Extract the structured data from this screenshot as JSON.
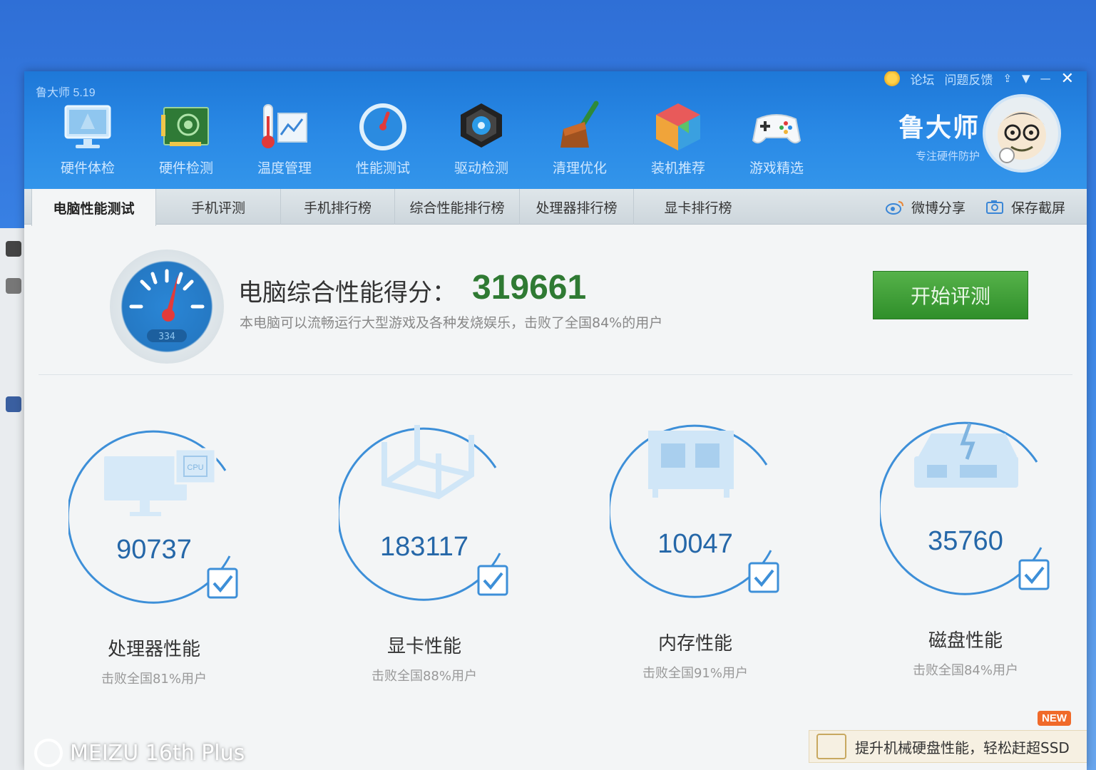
{
  "window": {
    "title": "鲁大师 5.19"
  },
  "title_links": {
    "forum": "论坛",
    "feedback": "问题反馈"
  },
  "toolbar": [
    {
      "label": "硬件体检",
      "icon": "monitor-icon"
    },
    {
      "label": "硬件检测",
      "icon": "circuit-board-icon"
    },
    {
      "label": "温度管理",
      "icon": "thermometer-icon"
    },
    {
      "label": "性能测试",
      "icon": "speedometer-icon"
    },
    {
      "label": "驱动检测",
      "icon": "driver-gear-icon"
    },
    {
      "label": "清理优化",
      "icon": "broom-icon"
    },
    {
      "label": "装机推荐",
      "icon": "cube-icon"
    },
    {
      "label": "游戏精选",
      "icon": "gamepad-icon"
    }
  ],
  "brand": {
    "name": "鲁大师",
    "slogan": "专注硬件防护"
  },
  "tabs": [
    {
      "label": "电脑性能测试",
      "active": true
    },
    {
      "label": "手机评测",
      "active": false
    },
    {
      "label": "手机排行榜",
      "active": false
    },
    {
      "label": "综合性能排行榜",
      "active": false
    },
    {
      "label": "处理器排行榜",
      "active": false
    },
    {
      "label": "显卡排行榜",
      "active": false
    }
  ],
  "tab_actions": {
    "weibo_share": "微博分享",
    "save_screenshot": "保存截屏"
  },
  "score": {
    "label": "电脑综合性能得分：",
    "value": "319661",
    "description": "本电脑可以流畅运行大型游戏及各种发烧娱乐，击败了全国84%的用户",
    "gauge_text": "334"
  },
  "start_button": "开始评测",
  "metrics": [
    {
      "name": "处理器性能",
      "score": "90737",
      "desc": "击败全国81%用户",
      "icon": "cpu-monitor-icon",
      "icon_text": "CPU"
    },
    {
      "name": "显卡性能",
      "score": "183117",
      "desc": "击败全国88%用户",
      "icon": "gpu-cube-icon"
    },
    {
      "name": "内存性能",
      "score": "10047",
      "desc": "击败全国91%用户",
      "icon": "memory-chip-icon"
    },
    {
      "name": "磁盘性能",
      "score": "35760",
      "desc": "击败全国84%用户",
      "icon": "disk-drive-icon"
    }
  ],
  "promo": {
    "badge": "NEW",
    "text": "提升机械硬盘性能，轻松赶超SSD"
  },
  "watermark": "MEIZU 16th Plus",
  "colors": {
    "accent": "#2a86d6",
    "score_green": "#2f7a33",
    "button_green": "#3a9a33",
    "circle_blue": "#3d8fd8"
  }
}
